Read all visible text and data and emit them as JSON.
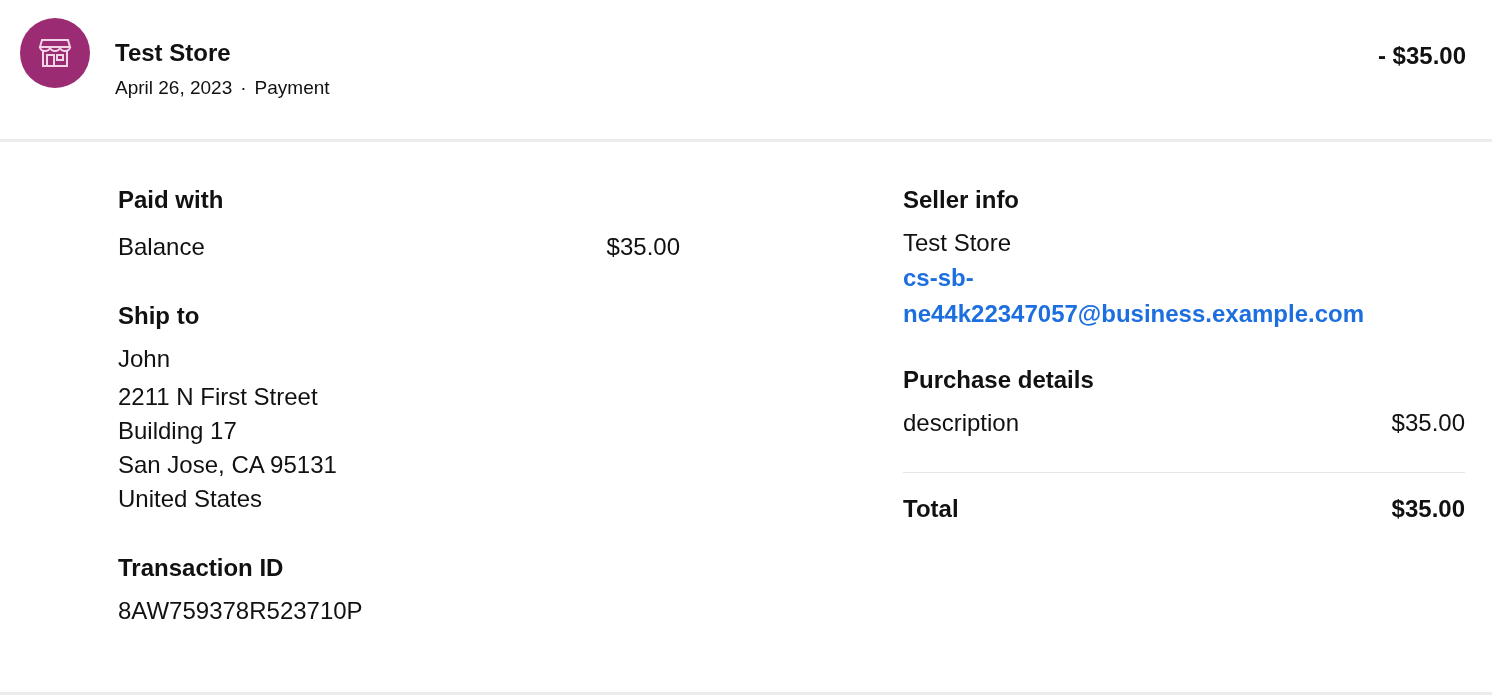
{
  "header": {
    "merchant": "Test Store",
    "date": "April 26, 2023",
    "separator": "·",
    "type": "Payment",
    "amount": "- $35.00"
  },
  "paid_with": {
    "heading": "Paid with",
    "rows": [
      {
        "label": "Balance",
        "amount": "$35.00"
      }
    ]
  },
  "ship_to": {
    "heading": "Ship to",
    "name": "John",
    "address": [
      "2211 N First Street",
      "Building 17",
      "San Jose, CA 95131",
      "United States"
    ]
  },
  "transaction": {
    "heading": "Transaction ID",
    "id": "8AW759378R523710P"
  },
  "seller_info": {
    "heading": "Seller info",
    "name": "Test Store",
    "email": "cs-sb-ne44k22347057@business.example.com"
  },
  "purchase_details": {
    "heading": "Purchase details",
    "items": [
      {
        "label": "description",
        "amount": "$35.00"
      }
    ],
    "total_label": "Total",
    "total": "$35.00"
  }
}
